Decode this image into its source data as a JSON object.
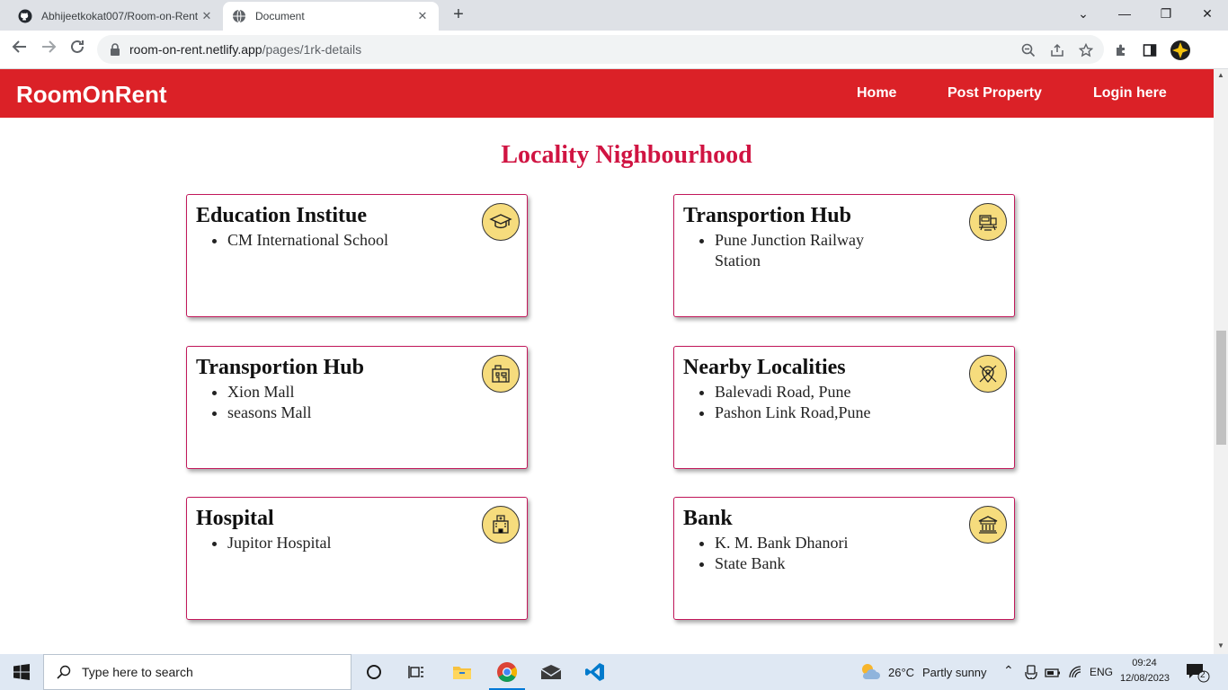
{
  "browser": {
    "tabs": [
      {
        "title": "Abhijeetkokat007/Room-on-Rent",
        "icon": "github-icon"
      },
      {
        "title": "Document",
        "icon": "globe-icon"
      }
    ],
    "url_host": "room-on-rent.netlify.app",
    "url_path": "/pages/1rk-details"
  },
  "navbar": {
    "brand": "RoomOnRent",
    "links": [
      "Home",
      "Post Property",
      "Login here"
    ],
    "bg_color": "#db2127"
  },
  "section": {
    "title": "Locality Nighbourhood",
    "title_color": "#d01442"
  },
  "cards": [
    {
      "title": "Education Institue",
      "icon": "graduation-cap-icon",
      "items": [
        "CM International School"
      ]
    },
    {
      "title": "Transportion Hub",
      "icon": "train-station-icon",
      "items": [
        "Pune Junction Railway Station"
      ]
    },
    {
      "title": "Transportion Hub",
      "icon": "shopping-mall-icon",
      "items": [
        "Xion Mall",
        "seasons Mall"
      ]
    },
    {
      "title": "Nearby Localities",
      "icon": "location-pin-icon",
      "items": [
        "Balevadi Road, Pune",
        "Pashon Link Road,Pune"
      ]
    },
    {
      "title": "Hospital",
      "icon": "hospital-icon",
      "items": [
        "Jupitor Hospital"
      ]
    },
    {
      "title": "Bank",
      "icon": "bank-icon",
      "items": [
        "K. M. Bank Dhanori",
        "State Bank"
      ]
    }
  ],
  "taskbar": {
    "search_placeholder": "Type here to search",
    "weather_temp": "26°C",
    "weather_text": "Partly sunny",
    "language": "ENG",
    "time": "09:24",
    "date": "12/08/2023",
    "notifications": "2"
  }
}
